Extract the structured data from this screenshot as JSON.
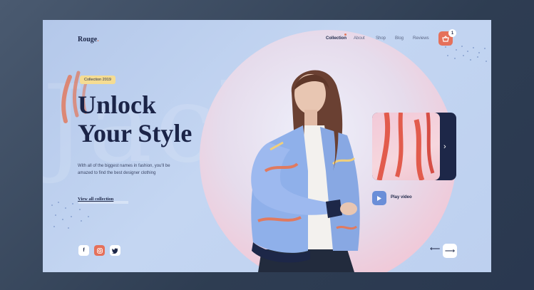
{
  "brand": {
    "name": "Rouge",
    "dot": "."
  },
  "nav": {
    "items": [
      "Collection",
      "About",
      "Shop",
      "Blog",
      "Reviews"
    ]
  },
  "cart": {
    "count": "1",
    "icon": "basket-icon"
  },
  "hero": {
    "tag": "Collection 2019",
    "headline_line1": "Unlock",
    "headline_line2": "Your Style",
    "description": "With all of the biggest names in fashion, you'll be amazed to find the best designer clothing",
    "cta": "View all collection",
    "watermark": "Jackets"
  },
  "social": {
    "facebook": "f",
    "instagram": "◎",
    "twitter": "🐦"
  },
  "video": {
    "label": "Play video"
  },
  "colors": {
    "accent": "#e5705a",
    "navy": "#1d2748",
    "tag": "#f5dc92",
    "play": "#6a8ed8",
    "background": "#b4c8ea"
  }
}
